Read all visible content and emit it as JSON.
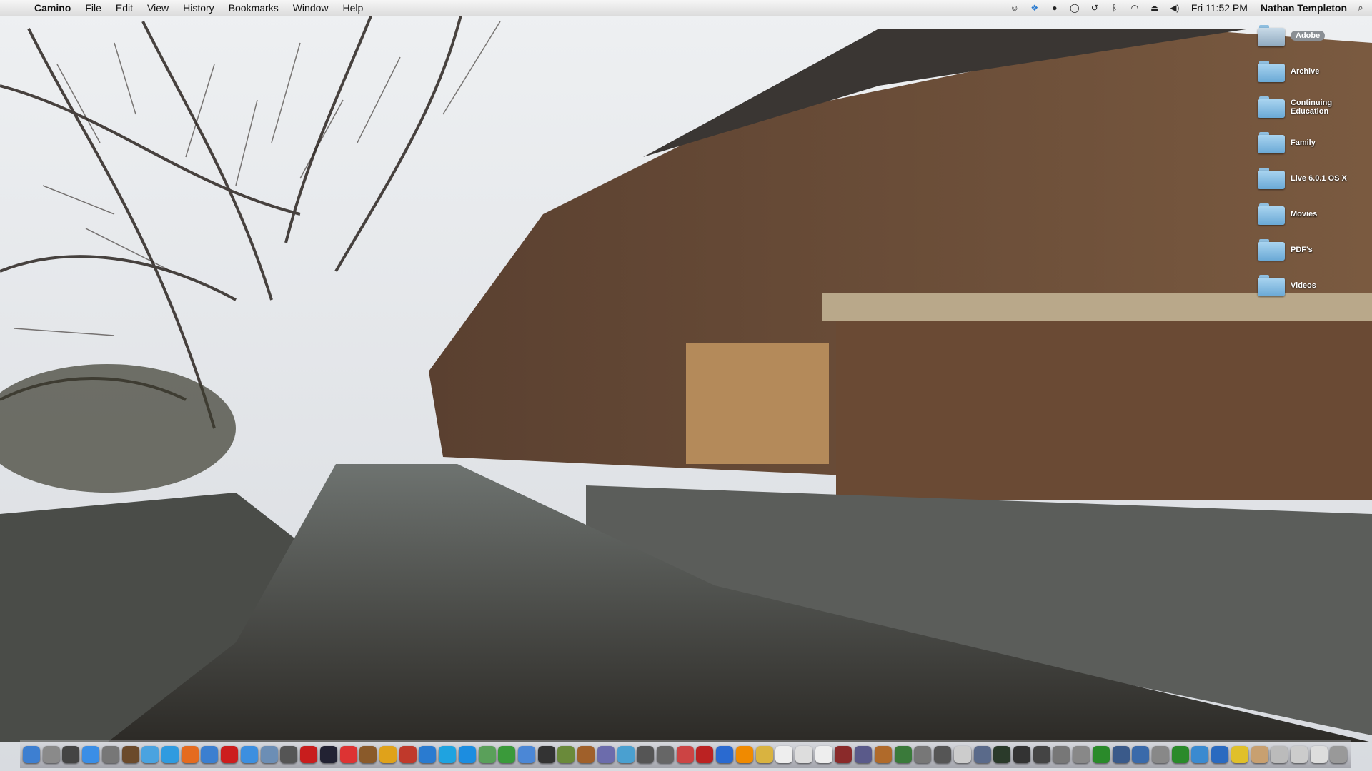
{
  "menubar": {
    "app_name": "Camino",
    "menus": [
      "File",
      "Edit",
      "View",
      "History",
      "Bookmarks",
      "Window",
      "Help"
    ],
    "status_icons": [
      "user-icon",
      "dropbox-icon",
      "growl-icon",
      "chat-icon",
      "time-machine-icon",
      "bluetooth-icon",
      "wifi-icon",
      "eject-icon",
      "volume-icon"
    ],
    "clock": "Fri 11:52 PM",
    "user": "Nathan Templeton"
  },
  "desktop": {
    "items": [
      {
        "label": "Adobe",
        "selected": true
      },
      {
        "label": "Archive"
      },
      {
        "label": "Continuing Education"
      },
      {
        "label": "Family"
      },
      {
        "label": "Live 6.0.1 OS X"
      },
      {
        "label": "Movies"
      },
      {
        "label": "PDF's"
      },
      {
        "label": "Videos"
      }
    ]
  },
  "dock": {
    "apps": [
      {
        "icon": "finder-icon",
        "color": "#3d7fd1"
      },
      {
        "icon": "system-preferences-icon",
        "color": "#8a8a8a"
      },
      {
        "icon": "dashboard-icon",
        "color": "#444"
      },
      {
        "icon": "safari-icon",
        "color": "#3a8ee6"
      },
      {
        "icon": "utility-icon",
        "color": "#777"
      },
      {
        "icon": "coffee-icon",
        "color": "#6b4a2b"
      },
      {
        "icon": "itunes-icon",
        "color": "#4aa3e0"
      },
      {
        "icon": "ichat-icon",
        "color": "#2f9be0"
      },
      {
        "icon": "firefox-icon",
        "color": "#e56b1f"
      },
      {
        "icon": "camino-icon",
        "color": "#3b7fd0"
      },
      {
        "icon": "opera-icon",
        "color": "#cc1d1d"
      },
      {
        "icon": "app-store-icon",
        "color": "#3c8fe0"
      },
      {
        "icon": "preview-icon",
        "color": "#6c8eb5"
      },
      {
        "icon": "screen-icon",
        "color": "#555"
      },
      {
        "icon": "acrobat-icon",
        "color": "#c81d1d"
      },
      {
        "icon": "terminal-app-icon",
        "color": "#223"
      },
      {
        "icon": "triangle-app-icon",
        "color": "#d33"
      },
      {
        "icon": "garageband-icon",
        "color": "#8a5a2a"
      },
      {
        "icon": "vlc-like-icon",
        "color": "#e0a21a"
      },
      {
        "icon": "filezilla-icon",
        "color": "#c0392b"
      },
      {
        "icon": "app-blue-icon",
        "color": "#2a7bd0"
      },
      {
        "icon": "skype-icon",
        "color": "#1fa3e0"
      },
      {
        "icon": "flickr-icon",
        "color": "#1c8de0"
      },
      {
        "icon": "chess-icon",
        "color": "#5aa05a"
      },
      {
        "icon": "green-app-icon",
        "color": "#3a9a3a"
      },
      {
        "icon": "itunes-app-icon",
        "color": "#4b87d6"
      },
      {
        "icon": "spider-icon",
        "color": "#333"
      },
      {
        "icon": "iphoto-icon",
        "color": "#6a8a3a"
      },
      {
        "icon": "guitar-icon",
        "color": "#a0602a"
      },
      {
        "icon": "photo-browser-icon",
        "color": "#6c6cac"
      },
      {
        "icon": "wifi-scanner-icon",
        "color": "#4aa0d0"
      },
      {
        "icon": "camera-icon",
        "color": "#555"
      },
      {
        "icon": "screenshot-icon",
        "color": "#666"
      },
      {
        "icon": "mail-icon",
        "color": "#c44"
      },
      {
        "icon": "photo-booth-icon",
        "color": "#b22"
      },
      {
        "icon": "quicktime-icon",
        "color": "#2a6ad0"
      },
      {
        "icon": "vlc-icon",
        "color": "#f08a00"
      },
      {
        "icon": "cd-icon",
        "color": "#d9b340"
      },
      {
        "icon": "calendar-icon",
        "color": "#eee"
      },
      {
        "icon": "textedit-icon",
        "color": "#ddd"
      },
      {
        "icon": "document-icon",
        "color": "#eee"
      },
      {
        "icon": "wine-icon",
        "color": "#8a2a2a"
      },
      {
        "icon": "pen-icon",
        "color": "#5a5a8a"
      },
      {
        "icon": "package-icon",
        "color": "#b06a2a"
      },
      {
        "icon": "charts-icon",
        "color": "#3a7a3a"
      },
      {
        "icon": "keyboard-icon",
        "color": "#777"
      },
      {
        "icon": "drive-icon",
        "color": "#555"
      },
      {
        "icon": "dvd-icon",
        "color": "#ccc"
      },
      {
        "icon": "helmet-icon",
        "color": "#5a6a8a"
      },
      {
        "icon": "activity-monitor-icon",
        "color": "#2a3a2a"
      },
      {
        "icon": "console-icon",
        "color": "#333"
      },
      {
        "icon": "x11-icon",
        "color": "#444"
      },
      {
        "icon": "automator-icon",
        "color": "#777"
      },
      {
        "icon": "installer-icon",
        "color": "#888"
      },
      {
        "icon": "green-screen-icon",
        "color": "#2a8a2a"
      },
      {
        "icon": "monitor-icon",
        "color": "#3a5a8a"
      },
      {
        "icon": "box-icon",
        "color": "#3a6aaa"
      },
      {
        "icon": "calculator-icon",
        "color": "#888"
      },
      {
        "icon": "utorrent-icon",
        "color": "#2a8a2a"
      },
      {
        "icon": "network-icon",
        "color": "#3a8ad0"
      },
      {
        "icon": "migration-icon",
        "color": "#2a6ac0"
      },
      {
        "icon": "stickies-icon",
        "color": "#e0c02a"
      },
      {
        "icon": "notes-icon",
        "color": "#c8a070"
      },
      {
        "icon": "downloads-stack-icon",
        "color": "#bbb"
      },
      {
        "icon": "documents-stack-icon",
        "color": "#ccc"
      },
      {
        "icon": "applications-stack-icon",
        "color": "#ddd"
      },
      {
        "icon": "trash-icon",
        "color": "#999"
      }
    ]
  }
}
